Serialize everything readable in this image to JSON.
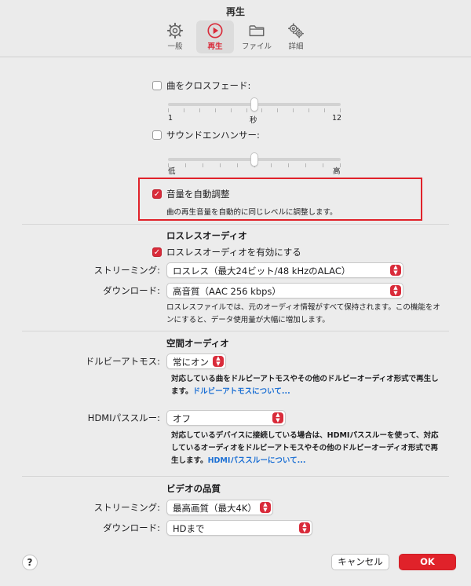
{
  "window": {
    "title": "再生"
  },
  "toolbar": {
    "tabs": [
      {
        "label": "一般",
        "icon": "gear-icon"
      },
      {
        "label": "再生",
        "icon": "play-circle-icon",
        "active": true
      },
      {
        "label": "ファイル",
        "icon": "folder-icon"
      },
      {
        "label": "詳細",
        "icon": "gears-icon"
      }
    ]
  },
  "crossfade": {
    "label": "曲をクロスフェード:",
    "checked": false,
    "slider": {
      "min_label": "1",
      "unit_label": "秒",
      "max_label": "12",
      "min": 1,
      "max": 12,
      "value": 6.5
    }
  },
  "sound_enhancer": {
    "label": "サウンドエンハンサー:",
    "checked": false,
    "slider": {
      "min_label": "低",
      "max_label": "高",
      "value": 0.5
    }
  },
  "sound_check": {
    "label": "音量を自動調整",
    "checked": true,
    "description": "曲の再生音量を自動的に同じレベルに調整します。"
  },
  "lossless": {
    "heading": "ロスレスオーディオ",
    "enable_label": "ロスレスオーディオを有効にする",
    "enabled": true,
    "streaming_label": "ストリーミング:",
    "streaming_value": "ロスレス（最大24ビット/48 kHzのALAC）",
    "download_label": "ダウンロード:",
    "download_value": "高音質（AAC 256 kbps）",
    "description_line1": "ロスレスファイルでは、元のオーディオ情報がすべて保持されます。この機能をオ",
    "description_line2": "ンにすると、データ使用量が大幅に増加します。"
  },
  "spatial": {
    "heading": "空間オーディオ",
    "dolby_label": "ドルビーアトモス:",
    "dolby_value": "常にオン",
    "dolby_desc_line1": "対応している曲をドルビーアトモスやその他のドルビーオーディオ形式で再生し",
    "dolby_desc_line2": "ます。",
    "dolby_link": "ドルビーアトモスについて...",
    "hdmi_label": "HDMIパススルー:",
    "hdmi_value": "オフ",
    "hdmi_desc_line1": "対応しているデバイスに接続している場合は、HDMIパススルーを使って、対応",
    "hdmi_desc_line2": "しているオーディオをドルビーアトモスやその他のドルビーオーディオ形式で再",
    "hdmi_desc_line3": "生します。",
    "hdmi_link": "HDMIパススルーについて..."
  },
  "video": {
    "heading": "ビデオの品質",
    "streaming_label": "ストリーミング:",
    "streaming_value": "最高画質（最大4K）",
    "download_label": "ダウンロード:",
    "download_value": "HDまで"
  },
  "footer": {
    "help": "?",
    "cancel": "キャンセル",
    "ok": "OK"
  },
  "colors": {
    "accent": "#d92b3a",
    "highlight_box": "#e0222a",
    "link": "#1b6fd4",
    "background": "#ececec"
  }
}
